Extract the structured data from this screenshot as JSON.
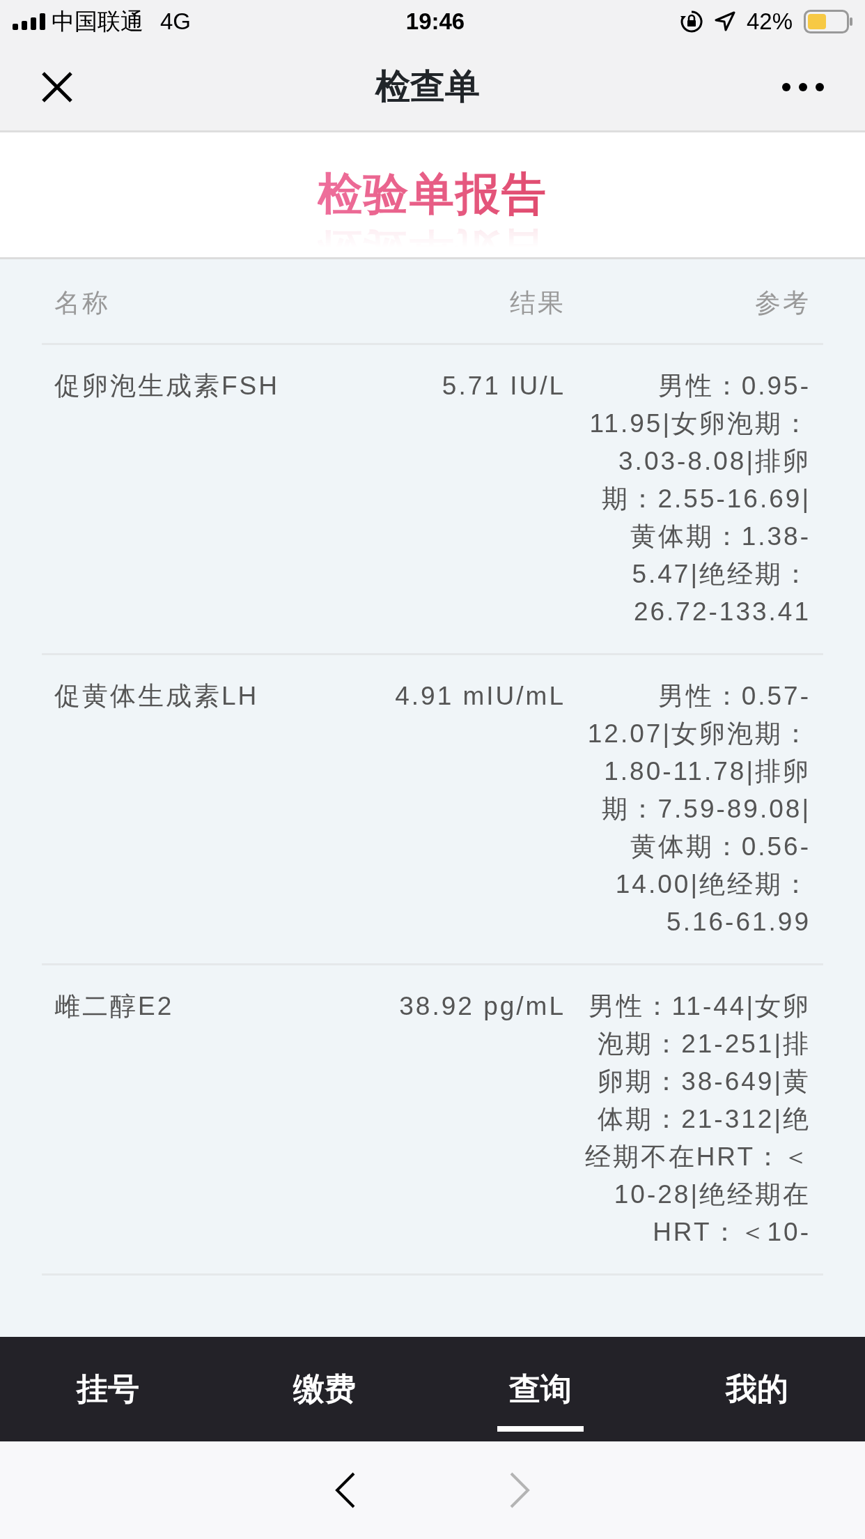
{
  "status_bar": {
    "carrier": "中国联通",
    "network": "4G",
    "time": "19:46",
    "battery_percent": "42%"
  },
  "nav_bar": {
    "title": "检查单"
  },
  "banner": {
    "title": "检验单报告"
  },
  "table": {
    "columns": [
      "名称",
      "结果",
      "参考"
    ],
    "rows": [
      {
        "name": "促卵泡生成素FSH",
        "result": "5.71 IU/L",
        "reference": "男性：0.95-11.95|女卵泡期：3.03-8.08|排卵期：2.55-16.69|黄体期：1.38-5.47|绝经期：26.72-133.41"
      },
      {
        "name": "促黄体生成素LH",
        "result": "4.91 mIU/mL",
        "reference": "男性：0.57-12.07|女卵泡期：1.80-11.78|排卵期：7.59-89.08|黄体期：0.56-14.00|绝经期：5.16-61.99"
      },
      {
        "name": "雌二醇E2",
        "result": "38.92 pg/mL",
        "reference": "男性：11-44|女卵泡期：21-251|排卵期：38-649|黄体期：21-312|绝经期不在HRT：＜10-28|绝经期在HRT：＜10-"
      }
    ]
  },
  "tab_bar": [
    {
      "label": "挂号",
      "selected": false
    },
    {
      "label": "缴费",
      "selected": false
    },
    {
      "label": "查询",
      "selected": true
    },
    {
      "label": "我的",
      "selected": false
    }
  ],
  "browser_toolbar": {
    "back_disabled": false,
    "forward_disabled": true
  }
}
